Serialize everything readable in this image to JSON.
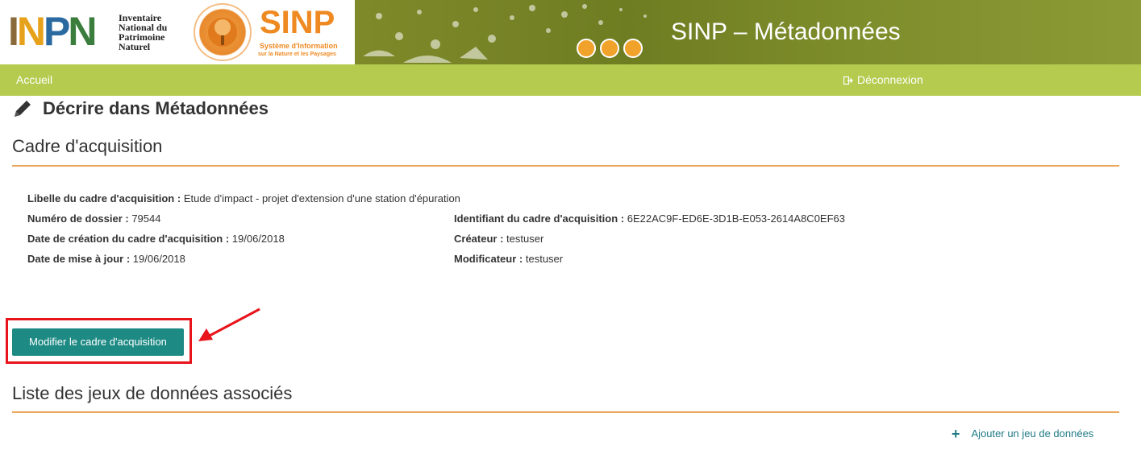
{
  "header": {
    "inpn_logo_letters": "INPN",
    "inpn_text_lines": [
      "Inventaire",
      "National du",
      "Patrimoine",
      "Naturel"
    ],
    "sinp_title": "SINP",
    "sinp_subtitle_1": "Système d'Information",
    "sinp_subtitle_2": "sur la Nature et les Paysages",
    "app_title": "SINP – Métadonnées"
  },
  "navbar": {
    "home": "Accueil",
    "logout": "Déconnexion"
  },
  "page": {
    "heading": "Décrire dans Métadonnées"
  },
  "cadre": {
    "section_title": "Cadre d'acquisition",
    "fields": {
      "libelle_label": "Libelle du cadre d'acquisition :",
      "libelle_value": "Etude d'impact - projet d'extension d'une station d'épuration",
      "numero_label": "Numéro de dossier :",
      "numero_value": "79544",
      "identifiant_label": "Identifiant du cadre d'acquisition :",
      "identifiant_value": "6E22AC9F-ED6E-3D1B-E053-2614A8C0EF63",
      "date_creation_label": "Date de création du cadre d'acquisition :",
      "date_creation_value": "19/06/2018",
      "createur_label": "Créateur :",
      "createur_value": "testuser",
      "date_maj_label": "Date de mise à jour :",
      "date_maj_value": "19/06/2018",
      "modificateur_label": "Modificateur :",
      "modificateur_value": "testuser"
    },
    "edit_button": "Modifier le cadre d'acquisition"
  },
  "jeux": {
    "section_title": "Liste des jeux de données associés",
    "add_link": "Ajouter un jeu de données"
  },
  "colors": {
    "navbar": "#b4cb4f",
    "accent_rule": "#eaa85a",
    "primary_button": "#1e8a84",
    "highlight_red": "#e8131b",
    "sinp_orange": "#ef8a22"
  }
}
